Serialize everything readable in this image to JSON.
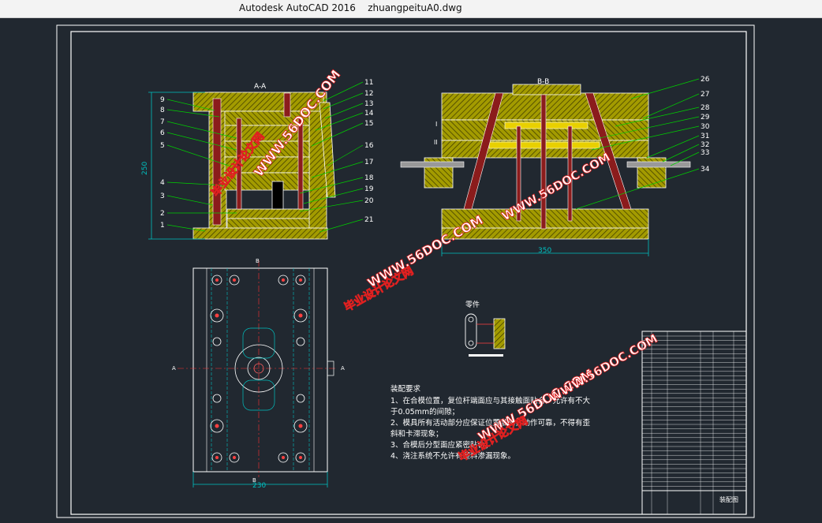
{
  "window": {
    "app_name": "Autodesk AutoCAD 2016",
    "file_name": "zhuangpeituA0.dwg"
  },
  "drawing": {
    "view_labels": {
      "section_aa": "A-A",
      "section_bb": "B-B",
      "plan_a": "A",
      "plan_b": "B"
    },
    "dimensions": {
      "height_left": "250",
      "width_right": "350",
      "width_plan": "230"
    },
    "left_callouts": [
      "9",
      "8",
      "7",
      "6",
      "5",
      "4",
      "3",
      "2",
      "1"
    ],
    "mid_callouts": [
      "11",
      "12",
      "13",
      "14",
      "15",
      "16",
      "17",
      "18",
      "19",
      "20",
      "21"
    ],
    "right_callouts": [
      "26",
      "27",
      "28",
      "29",
      "30",
      "31",
      "32",
      "33",
      "34"
    ],
    "parting_marks": [
      "I",
      "II"
    ],
    "part_label": "零件",
    "notes_title": "装配要求",
    "notes": [
      "1、在合模位置，复位杆端面应与其接触面贴合，允许有不大",
      "于0.05mm的间隙；",
      "2、模具所有活动部分应保证位置准确，动作可靠，不得有歪",
      "斜和卡滞现象；",
      "3、合模后分型面应紧密贴合；",
      "4、浇注系统不允许有塑料渗漏现象。"
    ],
    "title_block_name": "装配图",
    "watermarks": [
      "WWW.56DOC.COM",
      "毕业设计论文网"
    ]
  },
  "colors": {
    "background": "#212830",
    "hatch": "#a8a000",
    "lines": "#ffffff",
    "leaders": "#00d000",
    "dims": "#00c0c0"
  }
}
